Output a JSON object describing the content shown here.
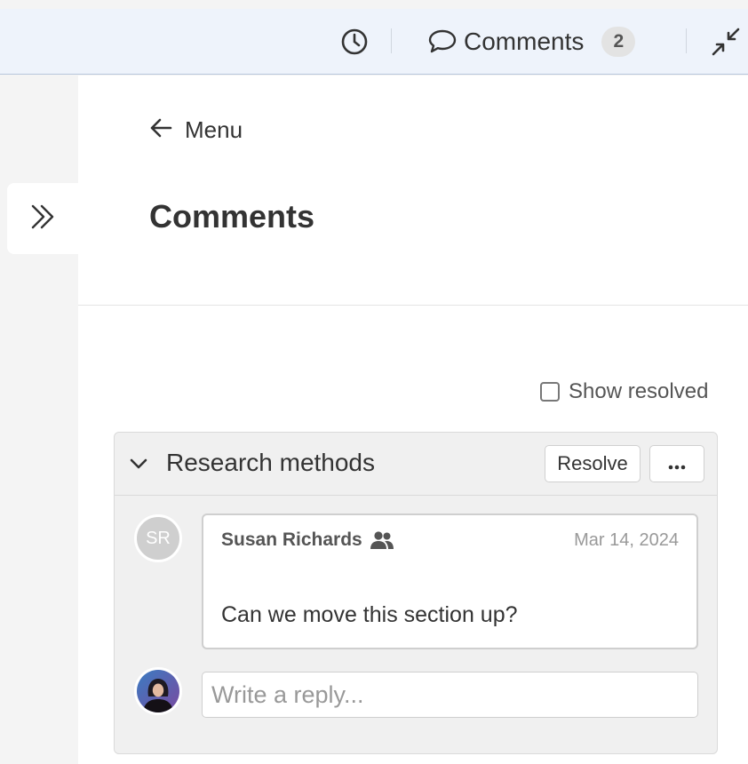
{
  "topbar": {
    "history_icon": "clock-icon",
    "comments_icon": "speech-bubble-icon",
    "comments_label": "Comments",
    "comments_count": "2",
    "collapse_icon": "minimize-arrows-icon"
  },
  "sidebar_toggle": {
    "icon": "double-chevron-right-icon"
  },
  "panel": {
    "back_icon": "arrow-left-icon",
    "back_label": "Menu",
    "title": "Comments",
    "show_resolved_label": "Show resolved",
    "show_resolved_checked": false
  },
  "thread": {
    "collapse_icon": "chevron-down-icon",
    "title": "Research methods",
    "resolve_label": "Resolve",
    "more_icon": "ellipsis-icon",
    "comments": [
      {
        "avatar_initials": "SR",
        "author": "Susan Richards",
        "author_icon": "people-icon",
        "date": "Mar 14, 2024",
        "text": "Can we move this section up?"
      }
    ],
    "reply_placeholder": "Write a reply..."
  },
  "colors": {
    "topbar_bg": "#eef3fb",
    "panel_bg": "#ffffff",
    "thread_bg": "#f0f0f0",
    "badge_bg": "#e3e3e3",
    "muted_text": "#999999"
  }
}
